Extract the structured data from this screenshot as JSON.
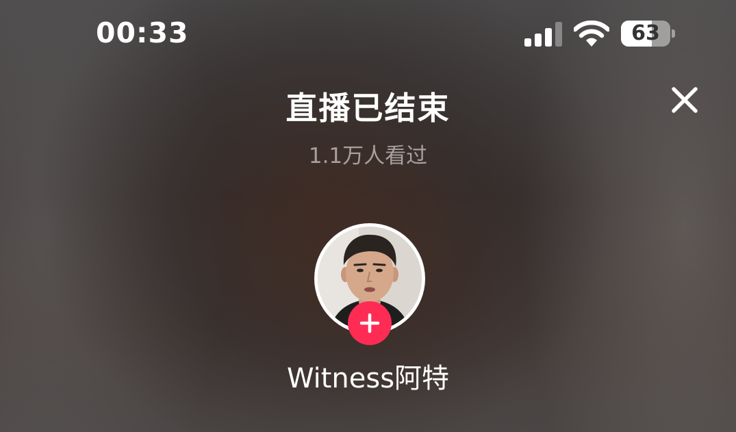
{
  "status_bar": {
    "time": "00:33",
    "signal_icon": "cellular-signal-icon",
    "wifi_icon": "wifi-icon",
    "battery_level": 63,
    "battery_label": "63"
  },
  "header": {
    "title": "直播已结束",
    "viewers": "1.1万人看过",
    "close_icon": "close-icon"
  },
  "host": {
    "username": "Witness阿特",
    "avatar": "host-avatar",
    "follow_icon": "plus-icon"
  },
  "colors": {
    "accent": "#fe2c55",
    "text": "#ffffff",
    "muted_text": "rgba(255,255,255,0.55)"
  }
}
